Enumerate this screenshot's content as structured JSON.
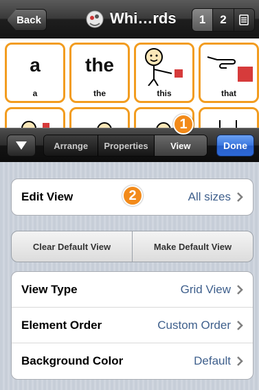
{
  "navbar": {
    "back_label": "Back",
    "title": "Whi…rds",
    "pages": [
      "1",
      "2"
    ],
    "avatar_icon": "wizard-avatar-icon",
    "extra_icon": "document-icon"
  },
  "grid": {
    "cells": [
      {
        "big": "a",
        "label": "a"
      },
      {
        "big": "the",
        "label": "the"
      },
      {
        "big": "",
        "label": "this",
        "icon": "person-pointing-icon"
      },
      {
        "big": "",
        "label": "that",
        "icon": "pointing-hand-icon"
      }
    ]
  },
  "toolbar": {
    "collapse_icon": "triangle-down-icon",
    "tabs": [
      "Arrange",
      "Properties",
      "View"
    ],
    "active_tab": "View",
    "done_label": "Done"
  },
  "panel": {
    "edit_view": {
      "label": "Edit View",
      "value": "All sizes"
    },
    "buttons": [
      "Clear Default View",
      "Make Default View"
    ],
    "settings": [
      {
        "label": "View Type",
        "value": "Grid View"
      },
      {
        "label": "Element Order",
        "value": "Custom Order"
      },
      {
        "label": "Background Color",
        "value": "Default"
      }
    ]
  },
  "badges": [
    "1",
    "2"
  ],
  "colors": {
    "cell_border": "#f29c1f",
    "value_text": "#3e5f8c",
    "done_button": "#2c68d6",
    "badge": "#f28a1a"
  }
}
